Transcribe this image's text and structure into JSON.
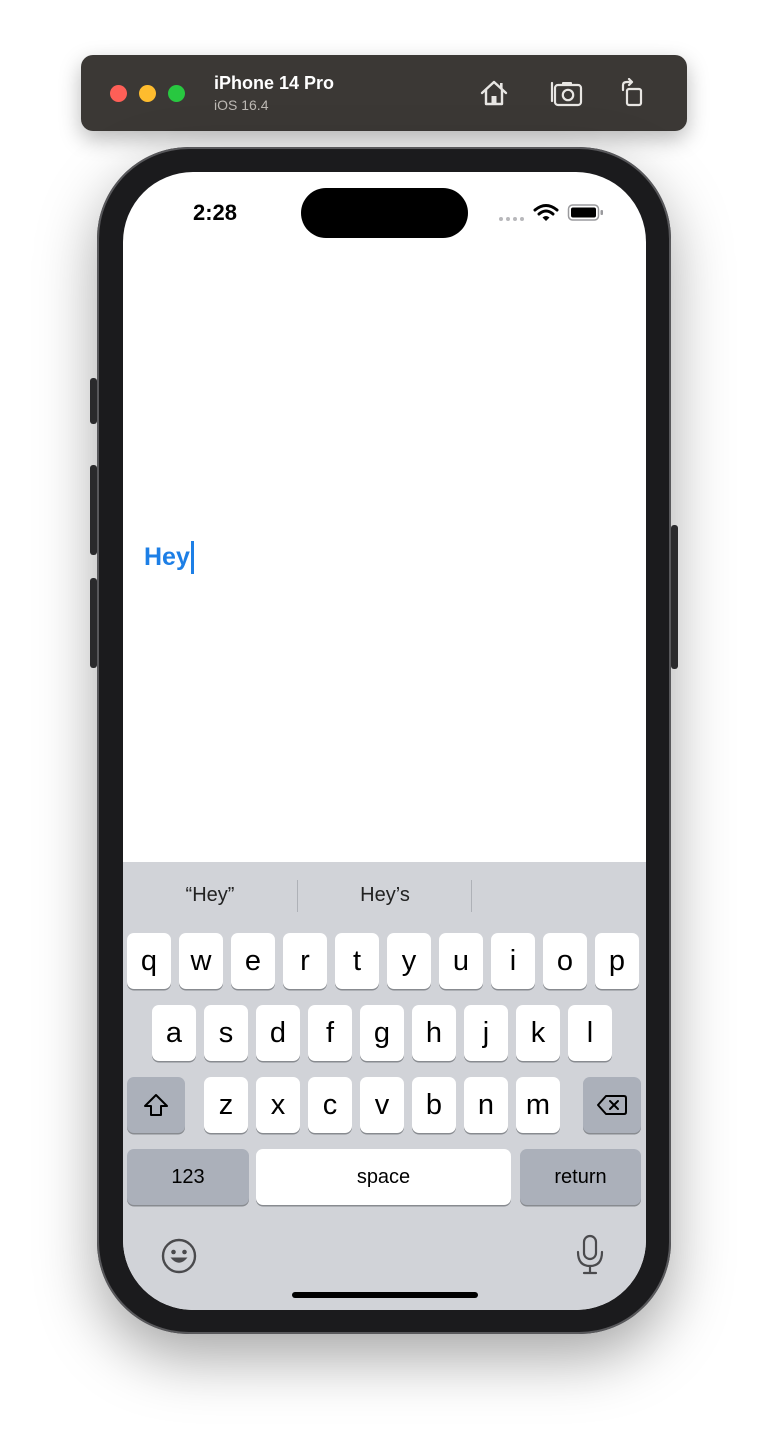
{
  "simulator": {
    "device_name": "iPhone 14 Pro",
    "os_version": "iOS 16.4",
    "icons": [
      "home-icon",
      "screenshot-icon",
      "rotate-icon"
    ]
  },
  "status_bar": {
    "time": "2:28",
    "icons": [
      "cellular-signal-icon",
      "wifi-icon",
      "battery-icon"
    ]
  },
  "text_field": {
    "value": "Hey",
    "color": "#1d7fe6"
  },
  "keyboard": {
    "suggestions": [
      "“Hey”",
      "Hey’s",
      ""
    ],
    "row1": [
      "q",
      "w",
      "e",
      "r",
      "t",
      "y",
      "u",
      "i",
      "o",
      "p"
    ],
    "row2": [
      "a",
      "s",
      "d",
      "f",
      "g",
      "h",
      "j",
      "k",
      "l"
    ],
    "row3": [
      "z",
      "x",
      "c",
      "v",
      "b",
      "n",
      "m"
    ],
    "numbers_label": "123",
    "space_label": "space",
    "return_label": "return",
    "icons": [
      "shift-icon",
      "delete-icon",
      "emoji-icon",
      "microphone-icon"
    ]
  }
}
